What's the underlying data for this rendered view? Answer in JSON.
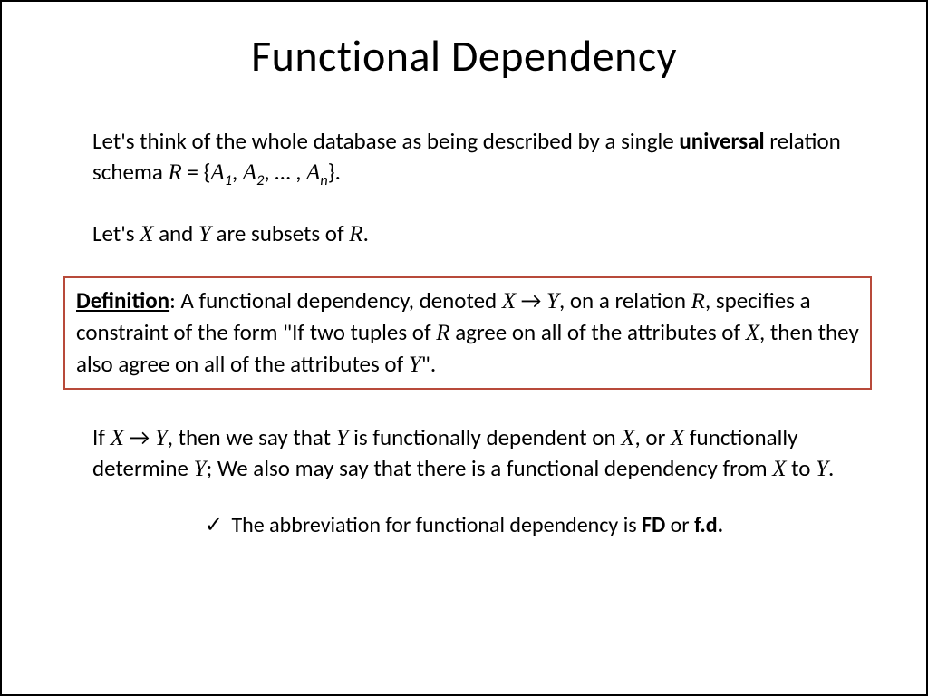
{
  "title": "Functional Dependency",
  "p1_a": "Let's think of the whole database as being described by a single ",
  "p1_b": "universal",
  "p1_c": " relation schema ",
  "p1_math_R": "R",
  "p1_eq": " =  {",
  "p1_A": "A",
  "p1_sub1": "1",
  "p1_comma1": ", ",
  "p1_sub2": "2",
  "p1_dots": ", … , ",
  "p1_subn": "n",
  "p1_close": "}.",
  "p2_a": "Let's ",
  "p2_X": "X",
  "p2_and": " and ",
  "p2_Y": "Y",
  "p2_b": " are subsets of ",
  "p2_R": "R",
  "p2_end": ".",
  "def_label": "Definition",
  "def_a": ": A functional dependency, denoted ",
  "def_X": "X",
  "def_arrow": " → ",
  "def_Y": "Y",
  "def_b": ", on a relation ",
  "def_R": "R",
  "def_c": ", specifies a constraint of the form \"If two tuples of ",
  "def_R2": "R",
  "def_d": " agree on all of the attributes of ",
  "def_X2": "X",
  "def_e": ", then they also agree on all of the attributes of ",
  "def_Y2": "Y",
  "def_f": "\".",
  "p4_a": "If ",
  "p4_X": "X",
  "p4_arrow": " → ",
  "p4_Y": "Y",
  "p4_b": ", then we say that ",
  "p4_Y2": "Y",
  "p4_c": " is functionally dependent on ",
  "p4_X2": "X",
  "p4_d": ", or ",
  "p4_X3": "X",
  "p4_e": " functionally determine ",
  "p4_Y3": "Y",
  "p4_f": "; We also may say that there is a functional dependency from ",
  "p4_X4": "X",
  "p4_g": " to ",
  "p4_Y4": "Y",
  "p4_h": ".",
  "footer_check": "✓",
  "footer_a": " The abbreviation for functional dependency is ",
  "footer_fd": "FD",
  "footer_or": " or ",
  "footer_fd2": "f.d."
}
